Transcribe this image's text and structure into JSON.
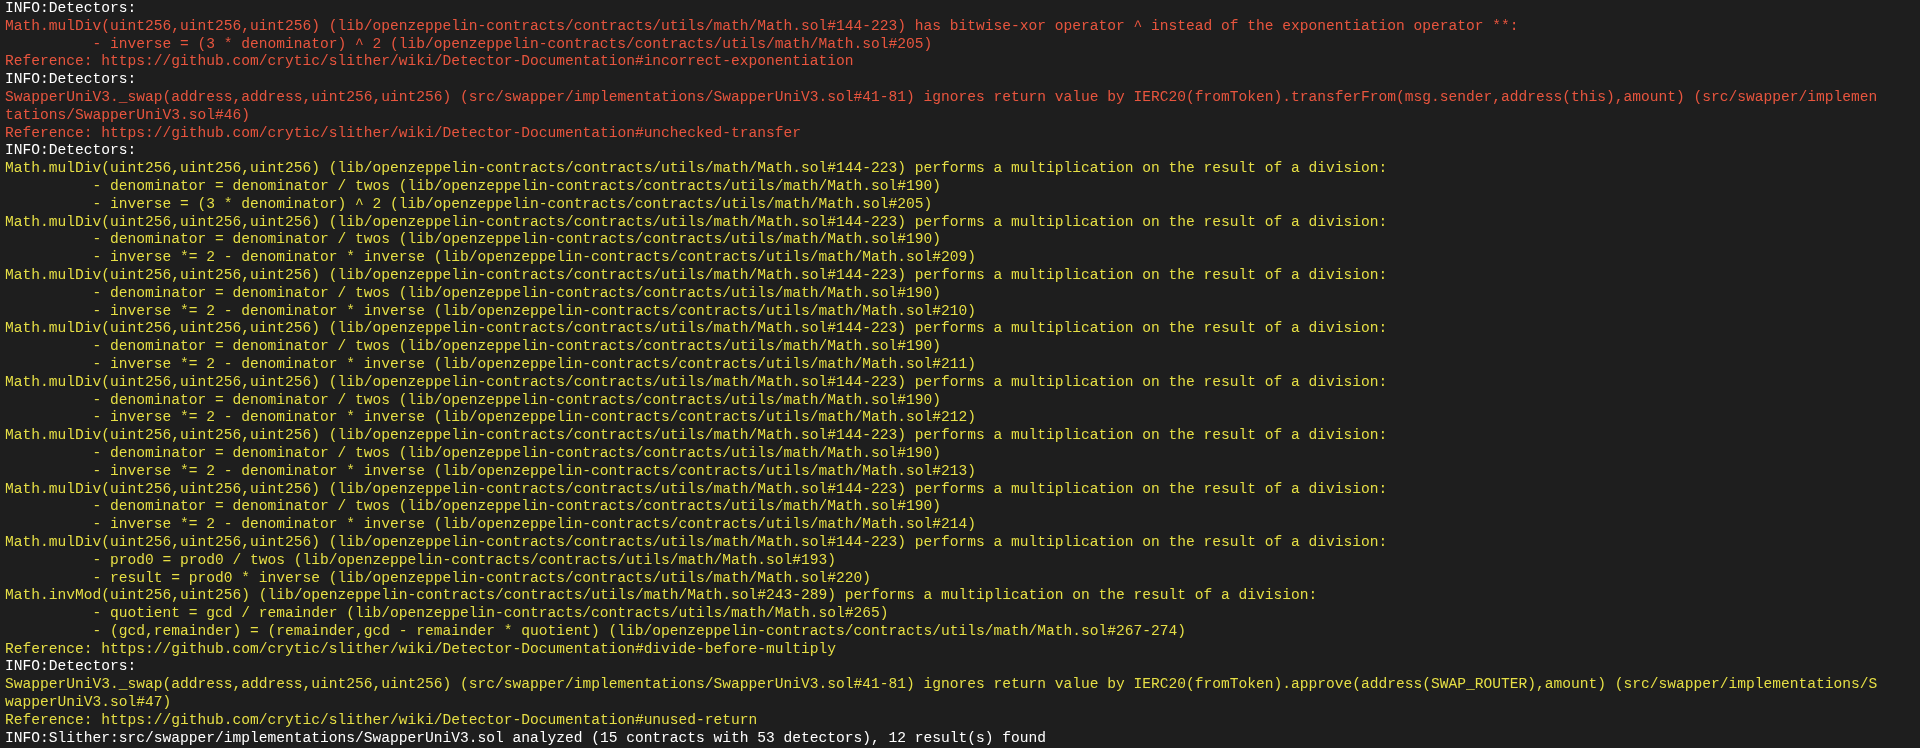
{
  "terminal": {
    "lines": [
      {
        "kind": "info",
        "color": "#ffffff",
        "text": "INFO:Detectors:"
      },
      {
        "kind": "finding",
        "color": "#e8553e",
        "text": "Math.mulDiv(uint256,uint256,uint256) (lib/openzeppelin-contracts/contracts/utils/math/Math.sol#144-223) has bitwise-xor operator ^ instead of the exponentiation operator **:"
      },
      {
        "kind": "detail",
        "color": "#e8553e",
        "text": "- inverse = (3 * denominator) ^ 2 (lib/openzeppelin-contracts/contracts/utils/math/Math.sol#205)"
      },
      {
        "kind": "reference",
        "color": "#e8553e",
        "text": "Reference: https://github.com/crytic/slither/wiki/Detector-Documentation#incorrect-exponentiation"
      },
      {
        "kind": "info",
        "color": "#ffffff",
        "text": "INFO:Detectors:"
      },
      {
        "kind": "finding",
        "color": "#e8553e",
        "text": "SwapperUniV3._swap(address,address,uint256,uint256) (src/swapper/implementations/SwapperUniV3.sol#41-81) ignores return value by IERC20(fromToken).transferFrom(msg.sender,address(this),amount) (src/swapper/implementations/SwapperUniV3.sol#46)"
      },
      {
        "kind": "reference",
        "color": "#e8553e",
        "text": "Reference: https://github.com/crytic/slither/wiki/Detector-Documentation#unchecked-transfer"
      },
      {
        "kind": "info",
        "color": "#ffffff",
        "text": "INFO:Detectors:"
      },
      {
        "kind": "finding",
        "color": "#e6df45",
        "text": "Math.mulDiv(uint256,uint256,uint256) (lib/openzeppelin-contracts/contracts/utils/math/Math.sol#144-223) performs a multiplication on the result of a division:"
      },
      {
        "kind": "detail",
        "color": "#e6df45",
        "text": "- denominator = denominator / twos (lib/openzeppelin-contracts/contracts/utils/math/Math.sol#190)"
      },
      {
        "kind": "detail",
        "color": "#e6df45",
        "text": "- inverse = (3 * denominator) ^ 2 (lib/openzeppelin-contracts/contracts/utils/math/Math.sol#205)"
      },
      {
        "kind": "finding",
        "color": "#e6df45",
        "text": "Math.mulDiv(uint256,uint256,uint256) (lib/openzeppelin-contracts/contracts/utils/math/Math.sol#144-223) performs a multiplication on the result of a division:"
      },
      {
        "kind": "detail",
        "color": "#e6df45",
        "text": "- denominator = denominator / twos (lib/openzeppelin-contracts/contracts/utils/math/Math.sol#190)"
      },
      {
        "kind": "detail",
        "color": "#e6df45",
        "text": "- inverse *= 2 - denominator * inverse (lib/openzeppelin-contracts/contracts/utils/math/Math.sol#209)"
      },
      {
        "kind": "finding",
        "color": "#e6df45",
        "text": "Math.mulDiv(uint256,uint256,uint256) (lib/openzeppelin-contracts/contracts/utils/math/Math.sol#144-223) performs a multiplication on the result of a division:"
      },
      {
        "kind": "detail",
        "color": "#e6df45",
        "text": "- denominator = denominator / twos (lib/openzeppelin-contracts/contracts/utils/math/Math.sol#190)"
      },
      {
        "kind": "detail",
        "color": "#e6df45",
        "text": "- inverse *= 2 - denominator * inverse (lib/openzeppelin-contracts/contracts/utils/math/Math.sol#210)"
      },
      {
        "kind": "finding",
        "color": "#e6df45",
        "text": "Math.mulDiv(uint256,uint256,uint256) (lib/openzeppelin-contracts/contracts/utils/math/Math.sol#144-223) performs a multiplication on the result of a division:"
      },
      {
        "kind": "detail",
        "color": "#e6df45",
        "text": "- denominator = denominator / twos (lib/openzeppelin-contracts/contracts/utils/math/Math.sol#190)"
      },
      {
        "kind": "detail",
        "color": "#e6df45",
        "text": "- inverse *= 2 - denominator * inverse (lib/openzeppelin-contracts/contracts/utils/math/Math.sol#211)"
      },
      {
        "kind": "finding",
        "color": "#e6df45",
        "text": "Math.mulDiv(uint256,uint256,uint256) (lib/openzeppelin-contracts/contracts/utils/math/Math.sol#144-223) performs a multiplication on the result of a division:"
      },
      {
        "kind": "detail",
        "color": "#e6df45",
        "text": "- denominator = denominator / twos (lib/openzeppelin-contracts/contracts/utils/math/Math.sol#190)"
      },
      {
        "kind": "detail",
        "color": "#e6df45",
        "text": "- inverse *= 2 - denominator * inverse (lib/openzeppelin-contracts/contracts/utils/math/Math.sol#212)"
      },
      {
        "kind": "finding",
        "color": "#e6df45",
        "text": "Math.mulDiv(uint256,uint256,uint256) (lib/openzeppelin-contracts/contracts/utils/math/Math.sol#144-223) performs a multiplication on the result of a division:"
      },
      {
        "kind": "detail",
        "color": "#e6df45",
        "text": "- denominator = denominator / twos (lib/openzeppelin-contracts/contracts/utils/math/Math.sol#190)"
      },
      {
        "kind": "detail",
        "color": "#e6df45",
        "text": "- inverse *= 2 - denominator * inverse (lib/openzeppelin-contracts/contracts/utils/math/Math.sol#213)"
      },
      {
        "kind": "finding",
        "color": "#e6df45",
        "text": "Math.mulDiv(uint256,uint256,uint256) (lib/openzeppelin-contracts/contracts/utils/math/Math.sol#144-223) performs a multiplication on the result of a division:"
      },
      {
        "kind": "detail",
        "color": "#e6df45",
        "text": "- denominator = denominator / twos (lib/openzeppelin-contracts/contracts/utils/math/Math.sol#190)"
      },
      {
        "kind": "detail",
        "color": "#e6df45",
        "text": "- inverse *= 2 - denominator * inverse (lib/openzeppelin-contracts/contracts/utils/math/Math.sol#214)"
      },
      {
        "kind": "finding",
        "color": "#e6df45",
        "text": "Math.mulDiv(uint256,uint256,uint256) (lib/openzeppelin-contracts/contracts/utils/math/Math.sol#144-223) performs a multiplication on the result of a division:"
      },
      {
        "kind": "detail",
        "color": "#e6df45",
        "text": "- prod0 = prod0 / twos (lib/openzeppelin-contracts/contracts/utils/math/Math.sol#193)"
      },
      {
        "kind": "detail",
        "color": "#e6df45",
        "text": "- result = prod0 * inverse (lib/openzeppelin-contracts/contracts/utils/math/Math.sol#220)"
      },
      {
        "kind": "finding",
        "color": "#e6df45",
        "text": "Math.invMod(uint256,uint256) (lib/openzeppelin-contracts/contracts/utils/math/Math.sol#243-289) performs a multiplication on the result of a division:"
      },
      {
        "kind": "detail",
        "color": "#e6df45",
        "text": "- quotient = gcd / remainder (lib/openzeppelin-contracts/contracts/utils/math/Math.sol#265)"
      },
      {
        "kind": "detail",
        "color": "#e6df45",
        "text": "- (gcd,remainder) = (remainder,gcd - remainder * quotient) (lib/openzeppelin-contracts/contracts/utils/math/Math.sol#267-274)"
      },
      {
        "kind": "reference",
        "color": "#e6df45",
        "text": "Reference: https://github.com/crytic/slither/wiki/Detector-Documentation#divide-before-multiply"
      },
      {
        "kind": "info",
        "color": "#ffffff",
        "text": "INFO:Detectors:"
      },
      {
        "kind": "finding",
        "color": "#e6df45",
        "text": "SwapperUniV3._swap(address,address,uint256,uint256) (src/swapper/implementations/SwapperUniV3.sol#41-81) ignores return value by IERC20(fromToken).approve(address(SWAP_ROUTER),amount) (src/swapper/implementations/SwapperUniV3.sol#47)"
      },
      {
        "kind": "reference",
        "color": "#e6df45",
        "text": "Reference: https://github.com/crytic/slither/wiki/Detector-Documentation#unused-return"
      },
      {
        "kind": "info",
        "color": "#ffffff",
        "text": "INFO:Slither:src/swapper/implementations/SwapperUniV3.sol analyzed (15 contracts with 53 detectors), 12 result(s) found"
      }
    ]
  }
}
